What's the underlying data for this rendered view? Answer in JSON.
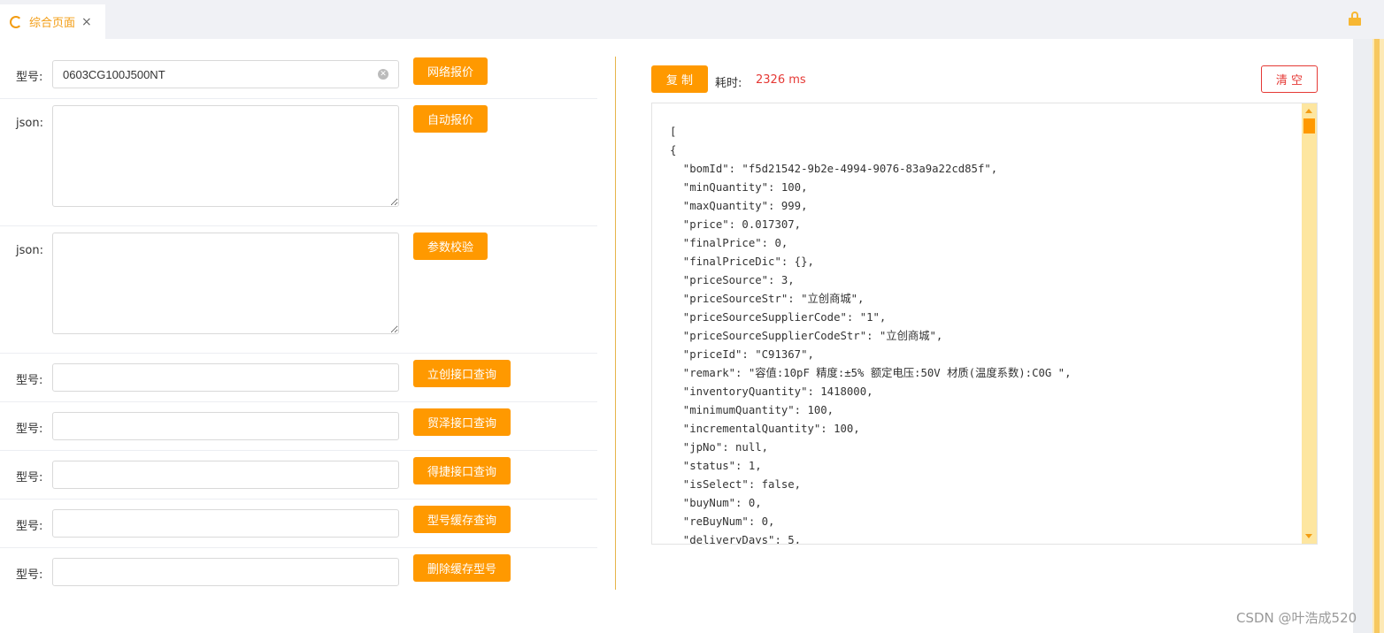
{
  "tabs": {
    "active_title": "综合页面",
    "close_glyph": "×"
  },
  "form": {
    "model_label": "型号:",
    "json_label": "json:",
    "model_value": "0603CG100J500NT",
    "buttons": {
      "network_quote": "网络报价",
      "auto_quote": "自动报价",
      "param_check": "参数校验",
      "lichuang_query": "立创接口查询",
      "maoze_query": "贸泽接口查询",
      "dejie_query": "得捷接口查询",
      "cache_query": "型号缓存查询",
      "delete_cache": "删除缓存型号"
    }
  },
  "result": {
    "copy_label": "复 制",
    "elapsed_label": "耗时:",
    "elapsed_value": "2326 ms",
    "clear_label": "清 空",
    "json_text": "[\n{\n  \"bomId\": \"f5d21542-9b2e-4994-9076-83a9a22cd85f\",\n  \"minQuantity\": 100,\n  \"maxQuantity\": 999,\n  \"price\": 0.017307,\n  \"finalPrice\": 0,\n  \"finalPriceDic\": {},\n  \"priceSource\": 3,\n  \"priceSourceStr\": \"立创商城\",\n  \"priceSourceSupplierCode\": \"1\",\n  \"priceSourceSupplierCodeStr\": \"立创商城\",\n  \"priceId\": \"C91367\",\n  \"remark\": \"容值:10pF 精度:±5% 额定电压:50V 材质(温度系数):C0G \",\n  \"inventoryQuantity\": 1418000,\n  \"minimumQuantity\": 100,\n  \"incrementalQuantity\": 100,\n  \"jpNo\": null,\n  \"status\": 1,\n  \"isSelect\": false,\n  \"buyNum\": 0,\n  \"reBuyNum\": 0,\n  \"deliveryDays\": 5,"
  },
  "watermark": "CSDN @叶浩成520",
  "colors": {
    "accent": "#ff9900",
    "danger": "#e53935"
  }
}
